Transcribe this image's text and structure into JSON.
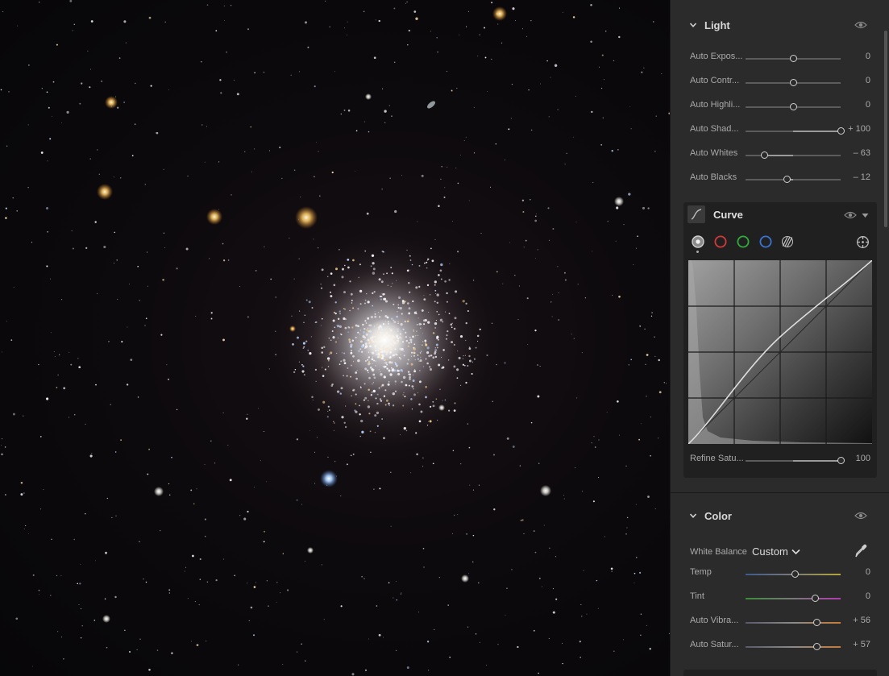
{
  "light": {
    "title": "Light",
    "rows": [
      {
        "label": "Auto Expos...",
        "value": "0",
        "pos": 0.5
      },
      {
        "label": "Auto Contr...",
        "value": "0",
        "pos": 0.5
      },
      {
        "label": "Auto Highli...",
        "value": "0",
        "pos": 0.5
      },
      {
        "label": "Auto Shad...",
        "value": "+ 100",
        "pos": 1.0
      },
      {
        "label": "Auto Whites",
        "value": "– 63",
        "pos": 0.2
      },
      {
        "label": "Auto Blacks",
        "value": "– 12",
        "pos": 0.44
      }
    ]
  },
  "curve": {
    "title": "Curve",
    "channels": [
      {
        "name": "point-curve",
        "color": "#c8c8c8"
      },
      {
        "name": "red-channel",
        "color": "#d23a3a"
      },
      {
        "name": "green-channel",
        "color": "#2fae3a"
      },
      {
        "name": "blue-channel",
        "color": "#3a73d6"
      }
    ],
    "refine": {
      "label": "Refine Satu...",
      "value": "100",
      "pos": 1.0
    }
  },
  "color": {
    "title": "Color",
    "white_balance_label": "White Balance",
    "white_balance_value": "Custom",
    "rows": [
      {
        "label": "Temp",
        "value": "0",
        "pos": 0.52,
        "gradient": "temp"
      },
      {
        "label": "Tint",
        "value": "0",
        "pos": 0.73,
        "gradient": "tint"
      },
      {
        "label": "Auto Vibra...",
        "value": "+ 56",
        "pos": 0.75,
        "gradient": "sat"
      },
      {
        "label": "Auto Satur...",
        "value": "+ 57",
        "pos": 0.75,
        "gradient": "sat"
      }
    ]
  }
}
